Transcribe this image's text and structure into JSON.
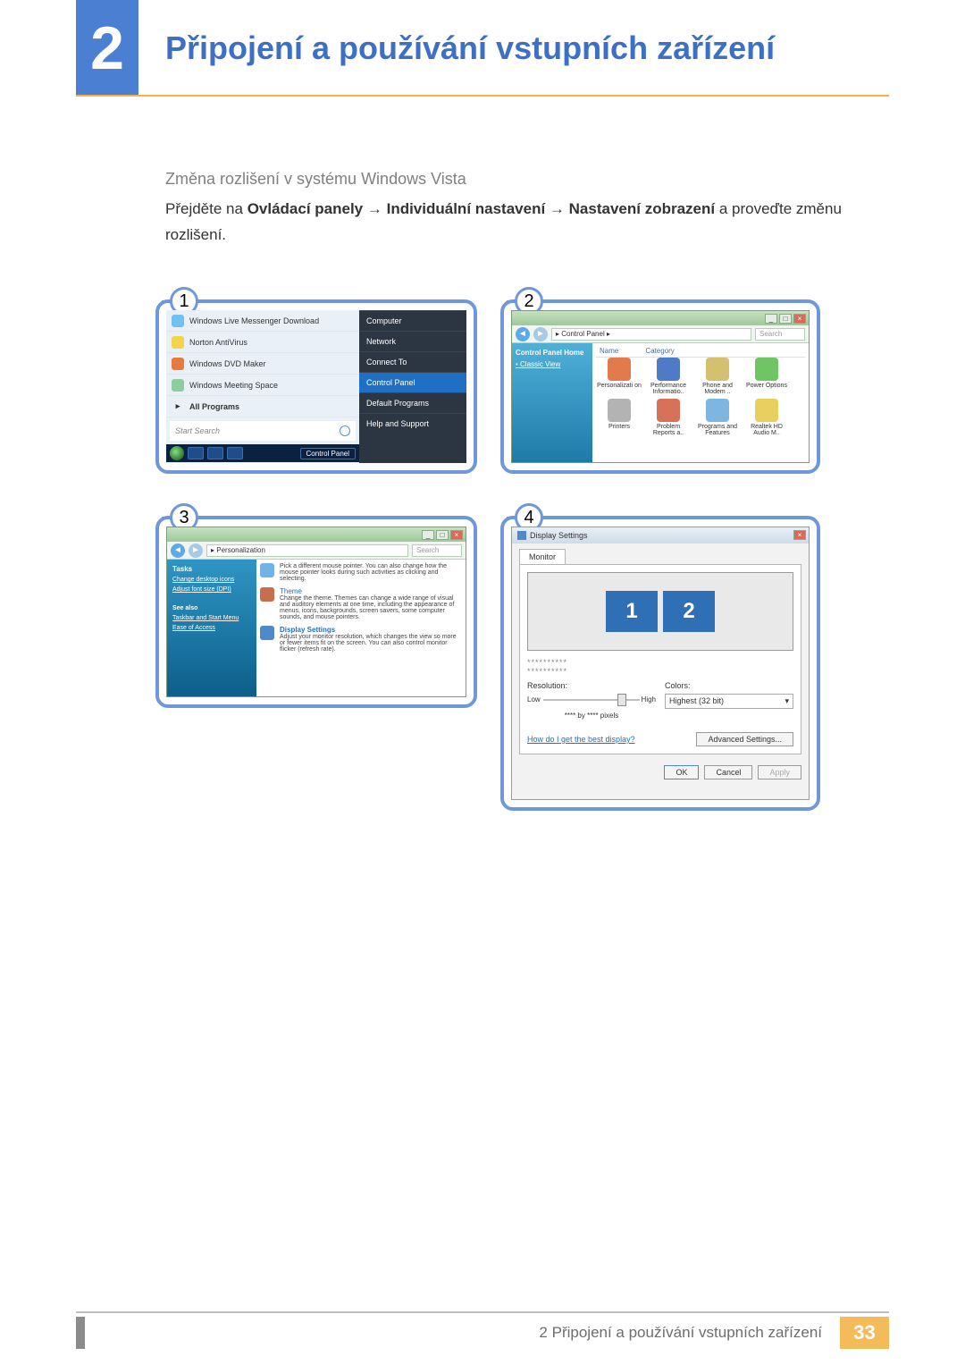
{
  "chapter": {
    "number": "2",
    "title": "Připojení a používání vstupních zařízení"
  },
  "section": {
    "subtitle": "Změna rozlišení v systému Windows Vista"
  },
  "instruction": {
    "prefix": "Přejděte na ",
    "b1": "Ovládací panely",
    "arrow": " → ",
    "b2": "Individuální nastavení",
    "b3": "Nastavení zobrazení",
    "suffix": " a proveďte změnu rozlišení."
  },
  "steps": {
    "n1": "1",
    "n2": "2",
    "n3": "3",
    "n4": "4"
  },
  "panel1": {
    "items": [
      "Windows Live Messenger Download",
      "Norton AntiVirus",
      "Windows DVD Maker",
      "Windows Meeting Space"
    ],
    "all_programs": "All Programs",
    "search_placeholder": "Start Search",
    "right": {
      "computer": "Computer",
      "network": "Network",
      "connect": "Connect To",
      "cp": "Control Panel",
      "defaults": "Default Programs",
      "help": "Help and Support"
    },
    "toolbar_cp": "Control Panel"
  },
  "panel2": {
    "address": "Control Panel",
    "search_placeholder": "Search",
    "side": {
      "home": "Control Panel Home",
      "classic": "Classic View"
    },
    "columns": {
      "name": "Name",
      "category": "Category"
    },
    "icons_row1": [
      "Personalizati on",
      "Performance Informatio..",
      "Phone and Modem ..",
      "Power Options"
    ],
    "icons_row2": [
      "Printers",
      "Problem Reports a..",
      "Programs and Features",
      "Realtek HD Audio M.."
    ]
  },
  "panel3": {
    "address": "Personalization",
    "search_placeholder": "Search",
    "side": {
      "tasks": "Tasks",
      "l1": "Change desktop icons",
      "l2": "Adjust font size (DPI)",
      "seealso": "See also",
      "l3": "Taskbar and Start Menu",
      "l4": "Ease of Access"
    },
    "items": [
      {
        "title": "",
        "desc": "Pick a different mouse pointer. You can also change how the mouse pointer looks during such activities as clicking and selecting."
      },
      {
        "title": "Theme",
        "desc": "Change the theme. Themes can change a wide range of visual and auditory elements at one time, including the appearance of menus, icons, backgrounds, screen savers, some computer sounds, and mouse pointers."
      },
      {
        "title": "Display Settings",
        "desc": "Adjust your monitor resolution, which changes the view so more or fewer items fit on the screen. You can also control monitor flicker (refresh rate)."
      }
    ]
  },
  "panel4": {
    "title": "Display Settings",
    "tab": "Monitor",
    "monitors": [
      "1",
      "2"
    ],
    "dots": "**********",
    "resolution_label": "Resolution:",
    "low": "Low",
    "high": "High",
    "by_pixels": "**** by **** pixels",
    "colors_label": "Colors:",
    "colors_value": "Highest (32 bit)",
    "help_link": "How do I get the best display?",
    "advanced": "Advanced Settings...",
    "ok": "OK",
    "cancel": "Cancel",
    "apply": "Apply"
  },
  "footer": {
    "text": "2 Připojení a používání vstupních zařízení",
    "page": "33"
  }
}
